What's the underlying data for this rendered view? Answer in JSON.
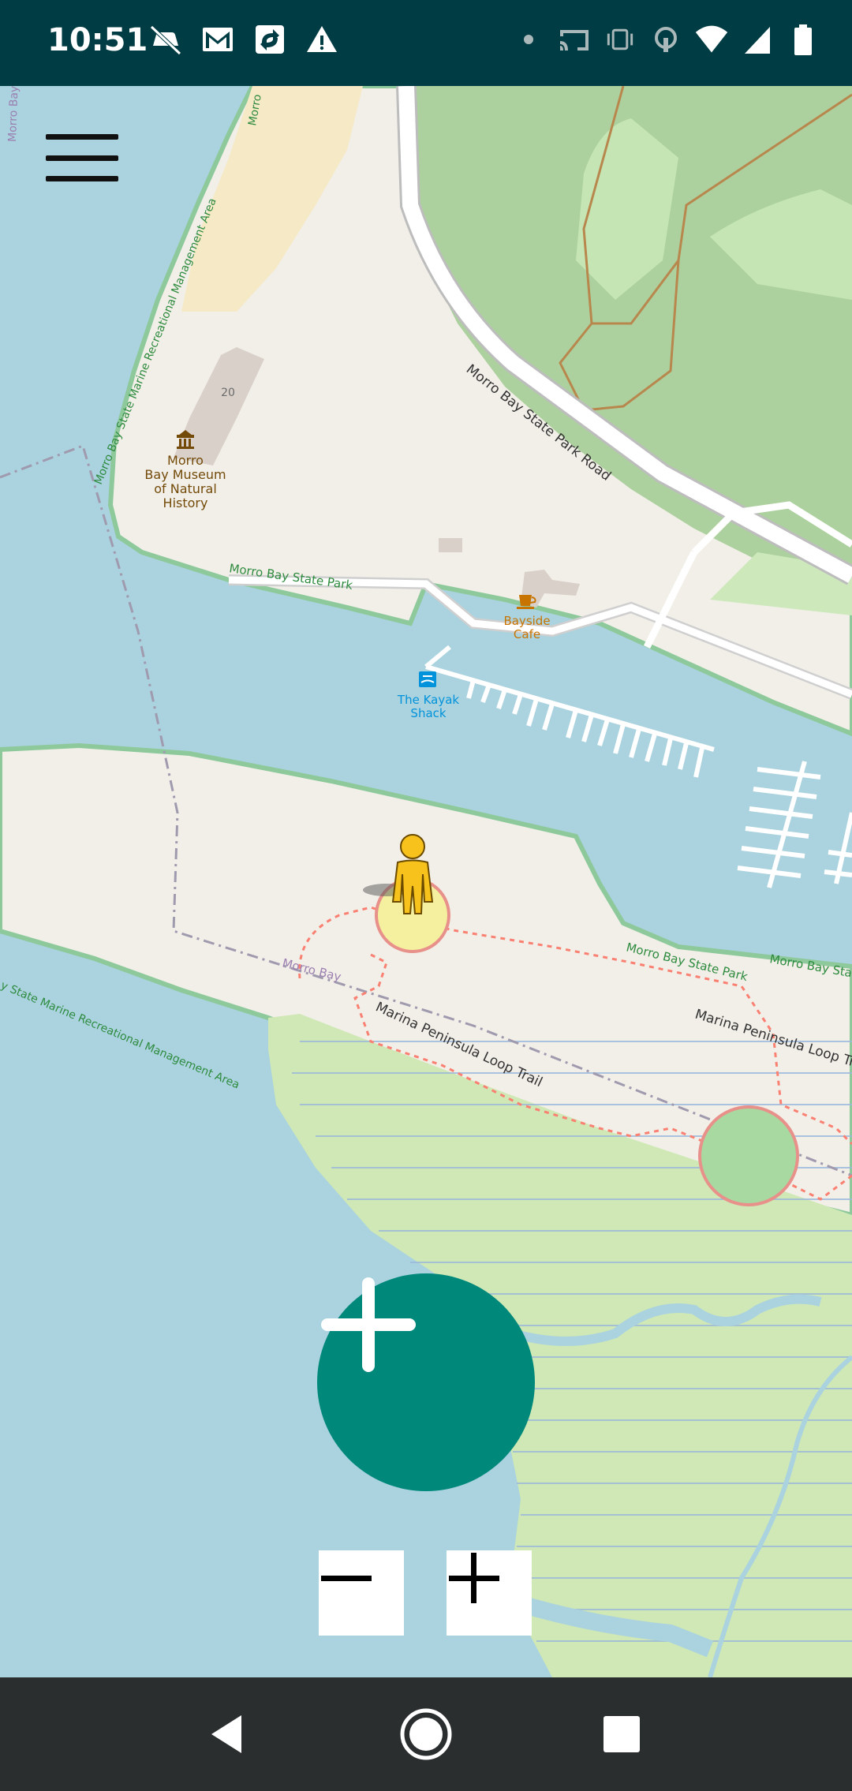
{
  "status_bar": {
    "time": "10:51",
    "left_icons": [
      "car-off-icon",
      "gmail-icon",
      "sync-icon",
      "warning-icon"
    ],
    "right_icons": [
      "dot-icon",
      "cast-icon",
      "vibrate-icon",
      "hotspot-icon",
      "wifi-icon",
      "signal-icon",
      "battery-icon"
    ]
  },
  "map": {
    "labels": {
      "museum": [
        "Morro",
        "Bay Museum",
        "of Natural",
        "History"
      ],
      "museum_number": "20",
      "park_road": "Morro Bay State Park Road",
      "state_park_1": "Morro Bay State Park",
      "state_park_2": "Morro Bay State Park",
      "state_park_3": "Morro Bay State",
      "cafe": [
        "Bayside",
        "Cafe"
      ],
      "kayak": [
        "The Kayak",
        "Shack"
      ],
      "morro_bay": "Morro Bay",
      "morro_bay_corner": "Morro Bay",
      "loop_trail_1": "Marina Peninsula Loop Trail",
      "loop_trail_2": "Marina Peninsula Loop Trai",
      "marine_area_1": "Morro Bay State Marine Recreational Management Area",
      "marine_area_2": "y State Marine Recreational Management Area",
      "morro_top": "Morro"
    },
    "colors": {
      "water": "#aad3df",
      "land": "#f2efe9",
      "park": "#add19e",
      "sand": "#f5e9c6",
      "wetland": "#cfe8b5",
      "park_border": "#8ec99b",
      "park_label": "#2e8b3e"
    }
  },
  "controls": {
    "menu_icon": "hamburger-menu-icon",
    "fab_icon": "plus-icon",
    "zoom_out_icon": "minus-icon",
    "zoom_in_icon": "plus-icon"
  },
  "nav_bar": {
    "back_icon": "back-triangle-icon",
    "home_icon": "home-circle-icon",
    "recents_icon": "recents-square-icon"
  }
}
